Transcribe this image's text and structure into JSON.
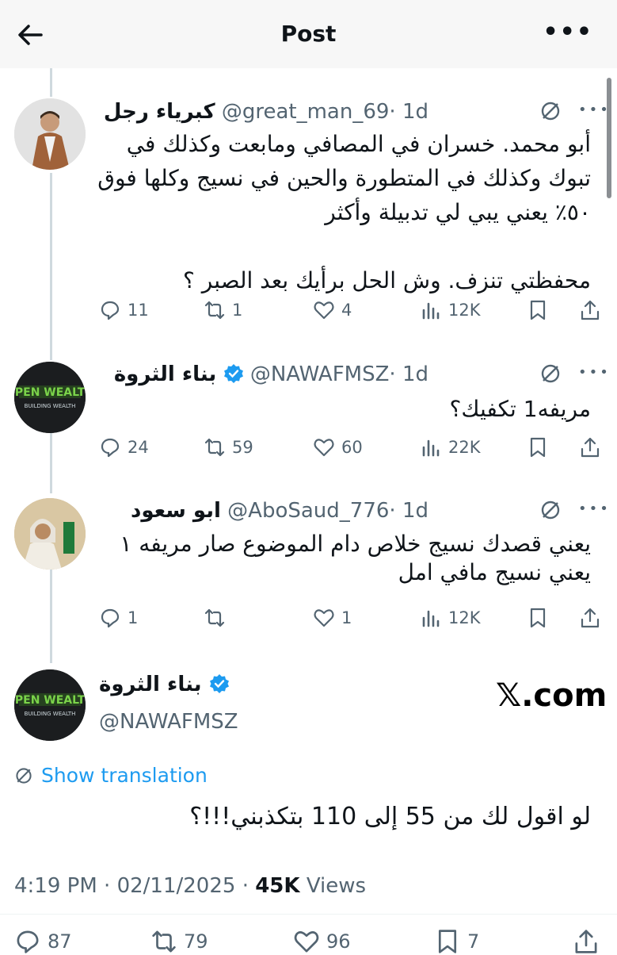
{
  "header": {
    "title": "Post"
  },
  "replies": [
    {
      "name": "كبرياء رجل",
      "handle": "@great_man_69",
      "time": "· 1d",
      "text": "أبو محمد. خسران في المصافي ومابعت وكذلك في تبوك وكذلك في المتطورة والحين في نسيج وكلها فوق ٥٠٪ يعني يبي لي تدبيلة وأكثر\n\nمحفظتي تنزف. وش الحل برأيك بعد الصبر ؟",
      "replies": "11",
      "reposts": "1",
      "likes": "4",
      "views": "12K"
    },
    {
      "name": "بناء الثروة",
      "handle": "@NAWAFMSZ",
      "time": "· 1d",
      "text": "مريفه1 تكفيك؟",
      "replies": "24",
      "reposts": "59",
      "likes": "60",
      "views": "22K"
    },
    {
      "name": "ابو سعود",
      "handle": "@AboSaud_776",
      "time": "· 1d",
      "text": "يعني قصدك نسيج خلاص دام الموضوع صار مريفه ١ يعني نسيج مافي امل",
      "replies": "1",
      "reposts": "",
      "likes": "1",
      "views": "12K"
    }
  ],
  "main": {
    "name": "بناء الثروة",
    "handle": "@NAWAFMSZ",
    "source": "𝕏.com",
    "translate": "Show translation",
    "text": "لو اقول لك من 55 إلى 110 بتكذبني!!!؟",
    "time": "4:19 PM",
    "date": "02/11/2025",
    "views_count": "45K",
    "views_label": "Views",
    "replies": "87",
    "reposts": "79",
    "likes": "96",
    "bookmarks": "7"
  },
  "avatar_text": {
    "logo": "BUILDING WEALTH"
  },
  "colors": {
    "accent": "#1d9bf0",
    "secondary": "#536471",
    "logo_green": "#7bd34a"
  }
}
